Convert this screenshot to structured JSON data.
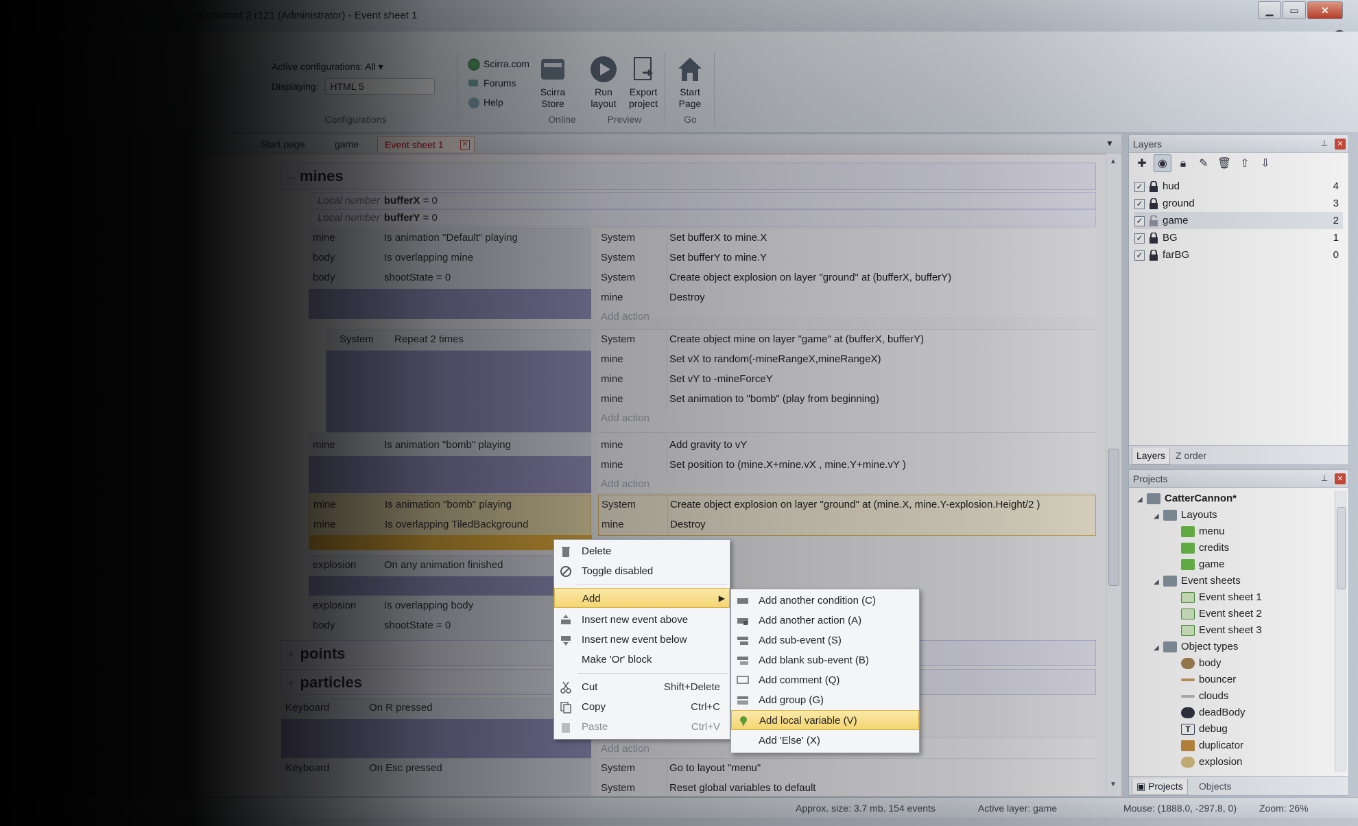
{
  "window": {
    "title": "Construct 2 r121 (Administrator) - Event sheet 1",
    "min": "▁",
    "max": "▭",
    "close": "✕"
  },
  "ribbon": {
    "config": {
      "active": "Active configurations: All ▾",
      "displaying_label": "Displaying:",
      "displaying_value": "HTML 5",
      "label": "Configurations"
    },
    "online": {
      "scirra": "Scirra.com",
      "forums": "Forums",
      "help": "Help",
      "store": "Scirra Store",
      "label": "Online"
    },
    "preview": {
      "run": "Run layout",
      "export": "Export project",
      "label": "Preview"
    },
    "go": {
      "start": "Start Page",
      "label": "Go"
    }
  },
  "tabs": {
    "start": "Start page",
    "game": "game",
    "active": "Event sheet 1"
  },
  "groups": {
    "mines": "mines",
    "points": "points",
    "particles": "particles"
  },
  "localvars": [
    {
      "kw": "Local number",
      "name": "bufferX",
      "val": "= 0"
    },
    {
      "kw": "Local number",
      "name": "bufferY",
      "val": "= 0"
    }
  ],
  "events": {
    "e1": {
      "conds": [
        [
          "mine",
          "Is animation \"Default\" playing"
        ],
        [
          "body",
          "Is overlapping  mine"
        ],
        [
          "body",
          "shootState = 0"
        ]
      ],
      "acts": [
        [
          "System",
          "Set bufferX to mine.X"
        ],
        [
          "System",
          "Set bufferY to mine.Y"
        ],
        [
          "System",
          "Create object  explosion on layer \"ground\" at (bufferX, bufferY)"
        ],
        [
          "mine",
          "Destroy"
        ]
      ]
    },
    "e2": {
      "conds": [
        [
          "System",
          "Repeat 2 times"
        ]
      ],
      "acts": [
        [
          "System",
          "Create object  mine on layer \"game\" at (bufferX, bufferY)"
        ],
        [
          "mine",
          "Set vX to random(-mineRangeX,mineRangeX)"
        ],
        [
          "mine",
          "Set vY to -mineForceY"
        ],
        [
          "mine",
          "Set animation to \"bomb\" (play from beginning)"
        ]
      ]
    },
    "e3": {
      "conds": [
        [
          "mine",
          "Is animation \"bomb\" playing"
        ]
      ],
      "acts": [
        [
          "mine",
          "Add gravity to vY"
        ],
        [
          "mine",
          "Set position to (mine.X+mine.vX , mine.Y+mine.vY )"
        ]
      ]
    },
    "e4": {
      "conds": [
        [
          "mine",
          "Is animation \"bomb\" playing"
        ],
        [
          "mine",
          "Is overlapping  TiledBackground"
        ]
      ],
      "acts": [
        [
          "System",
          "Create object  explosion on layer \"ground\" at (mine.X, mine.Y-explosion.Height/2 )"
        ],
        [
          "mine",
          "Destroy"
        ]
      ]
    },
    "e5": {
      "conds": [
        [
          "explosion",
          "On any animation finished"
        ]
      ]
    },
    "e6": {
      "conds": [
        [
          "explosion",
          "Is overlapping  body"
        ],
        [
          "body",
          "shootState = 0"
        ]
      ]
    },
    "e7": {
      "conds": [
        [
          "Keyboard",
          "On R pressed"
        ]
      ]
    },
    "e8": {
      "conds": [
        [
          "Keyboard",
          "On Esc pressed"
        ]
      ],
      "acts": [
        [
          "System",
          "Go to layout \"menu\""
        ],
        [
          "System",
          "Reset global variables to default"
        ]
      ]
    },
    "add_action": "Add action"
  },
  "layers": {
    "title": "Layers",
    "items": [
      [
        "hud",
        "4"
      ],
      [
        "ground",
        "3"
      ],
      [
        "game",
        "2"
      ],
      [
        "BG",
        "1"
      ],
      [
        "farBG",
        "0"
      ]
    ],
    "tab1": "Layers",
    "tab2": "Z order"
  },
  "projects": {
    "title": "Projects",
    "root": "CatterCannon*",
    "layouts": "Layouts",
    "layout_items": [
      "menu",
      "credits",
      "game"
    ],
    "sheets": "Event sheets",
    "sheet_items": [
      "Event sheet 1",
      "Event sheet 2",
      "Event sheet 3"
    ],
    "objtypes": "Object types",
    "obj_items": [
      "body",
      "bouncer",
      "clouds",
      "deadBody",
      "debug",
      "duplicator",
      "explosion"
    ],
    "tab1": "Projects",
    "tab2": "Objects"
  },
  "status": {
    "size": "Approx. size: 3.7 mb. 154 events",
    "layer": "Active layer: game",
    "mouse": "Mouse: (1888.0, -297.8, 0)",
    "zoom": "Zoom: 26%"
  },
  "menu1": {
    "delete": "Delete",
    "toggle": "Toggle disabled",
    "add": "Add",
    "insert_above": "Insert new event above",
    "insert_below": "Insert new event below",
    "or_block": "Make 'Or' block",
    "cut": "Cut",
    "cut_sc": "Shift+Delete",
    "copy": "Copy",
    "copy_sc": "Ctrl+C",
    "paste": "Paste",
    "paste_sc": "Ctrl+V"
  },
  "menu2": {
    "cond": "Add another condition (C)",
    "action": "Add another action (A)",
    "sub": "Add sub-event (S)",
    "blank": "Add blank sub-event (B)",
    "comment": "Add comment (Q)",
    "group": "Add group (G)",
    "localvar": "Add local variable (V)",
    "else": "Add 'Else' (X)"
  },
  "colors": {
    "accent": "#f4d572",
    "group_bg": "#ecebf8",
    "sub_blank": "#9c98c8"
  }
}
